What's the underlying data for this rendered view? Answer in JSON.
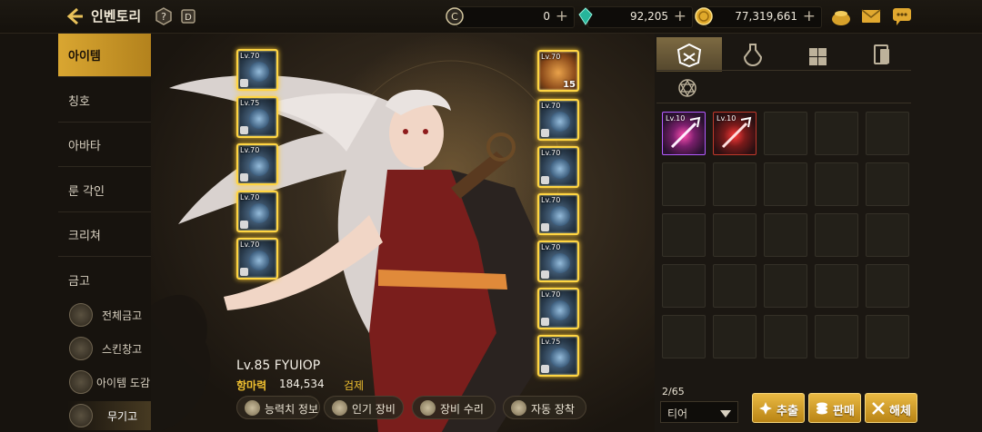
{
  "header": {
    "title": "인벤토리",
    "help_icon": "help-hex-icon",
    "dict_icon": "d-hex-icon"
  },
  "currencies": [
    {
      "name": "crystal-c",
      "value": "0",
      "icon": "c-coin-icon"
    },
    {
      "name": "gem",
      "value": "92,205",
      "icon": "green-gem-icon"
    },
    {
      "name": "gold",
      "value": "77,319,661",
      "icon": "gold-coin-icon"
    }
  ],
  "top_icons": [
    "gold-pot-icon",
    "mail-icon",
    "chat-icon"
  ],
  "sidebar": {
    "items": [
      {
        "label": "아이템"
      },
      {
        "label": "칭호"
      },
      {
        "label": "아바타"
      },
      {
        "label": "룬 각인"
      },
      {
        "label": "크리쳐"
      },
      {
        "label": "금고"
      }
    ],
    "subitems": [
      {
        "label": "전체금고",
        "icon": "vault-icon"
      },
      {
        "label": "스킨창고",
        "icon": "brush-icon"
      },
      {
        "label": "아이템 도감",
        "icon": "book-icon"
      },
      {
        "label": "무기고",
        "icon": "armor-icon"
      }
    ]
  },
  "character": {
    "name": "Lv.85 FYUIOP",
    "power_label": "항마력",
    "power_value": "184,534",
    "class": "검제"
  },
  "equipment": {
    "left": [
      {
        "level": "Lv.70"
      },
      {
        "level": "Lv.75"
      },
      {
        "level": "Lv.70"
      },
      {
        "level": "Lv.70"
      },
      {
        "level": "Lv.70"
      }
    ],
    "right": [
      {
        "level": "Lv.70",
        "count": "15"
      },
      {
        "level": "Lv.70"
      },
      {
        "level": "Lv.70"
      },
      {
        "level": "Lv.70"
      },
      {
        "level": "Lv.70"
      },
      {
        "level": "Lv.70"
      },
      {
        "level": "Lv.75"
      }
    ]
  },
  "actions": [
    {
      "label": "능력치 정보",
      "icon": "stats-icon"
    },
    {
      "label": "인기 장비",
      "icon": "popular-icon"
    },
    {
      "label": "장비 수리",
      "icon": "repair-icon"
    },
    {
      "label": "자동 장착",
      "icon": "auto-equip-icon"
    }
  ],
  "inventory": {
    "tabs": [
      "equipment-tab-icon",
      "potion-tab-icon",
      "material-tab-icon",
      "card-tab-icon",
      "rune-tab-icon"
    ],
    "items": [
      {
        "level": "Lv.10"
      },
      {
        "level": "Lv.10"
      }
    ],
    "slot_count": "2/65",
    "filter": "티어",
    "buttons": [
      {
        "label": "추출",
        "icon": "extract-icon"
      },
      {
        "label": "판매",
        "icon": "sell-icon"
      },
      {
        "label": "해체",
        "icon": "disassemble-icon"
      }
    ]
  },
  "colors": {
    "accent_gold": "#d9a631",
    "power_yellow": "#f0c030",
    "epic_purple": "#b45cff"
  }
}
